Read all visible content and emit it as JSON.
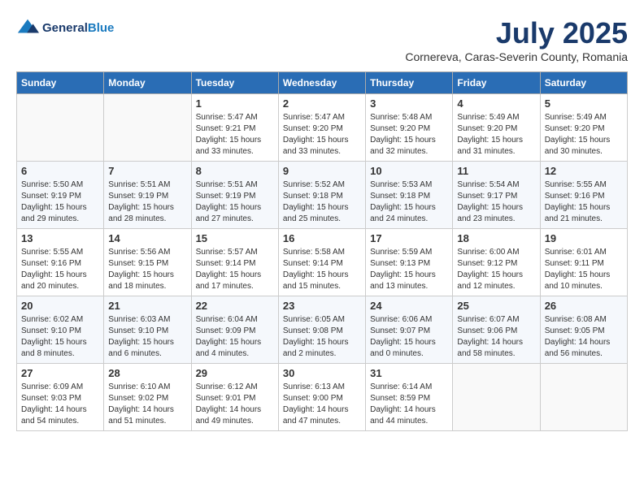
{
  "logo": {
    "general": "General",
    "blue": "Blue"
  },
  "title": "July 2025",
  "subtitle": "Cornereva, Caras-Severin County, Romania",
  "days_header": [
    "Sunday",
    "Monday",
    "Tuesday",
    "Wednesday",
    "Thursday",
    "Friday",
    "Saturday"
  ],
  "weeks": [
    [
      {
        "num": "",
        "detail": ""
      },
      {
        "num": "",
        "detail": ""
      },
      {
        "num": "1",
        "detail": "Sunrise: 5:47 AM\nSunset: 9:21 PM\nDaylight: 15 hours and 33 minutes."
      },
      {
        "num": "2",
        "detail": "Sunrise: 5:47 AM\nSunset: 9:20 PM\nDaylight: 15 hours and 33 minutes."
      },
      {
        "num": "3",
        "detail": "Sunrise: 5:48 AM\nSunset: 9:20 PM\nDaylight: 15 hours and 32 minutes."
      },
      {
        "num": "4",
        "detail": "Sunrise: 5:49 AM\nSunset: 9:20 PM\nDaylight: 15 hours and 31 minutes."
      },
      {
        "num": "5",
        "detail": "Sunrise: 5:49 AM\nSunset: 9:20 PM\nDaylight: 15 hours and 30 minutes."
      }
    ],
    [
      {
        "num": "6",
        "detail": "Sunrise: 5:50 AM\nSunset: 9:19 PM\nDaylight: 15 hours and 29 minutes."
      },
      {
        "num": "7",
        "detail": "Sunrise: 5:51 AM\nSunset: 9:19 PM\nDaylight: 15 hours and 28 minutes."
      },
      {
        "num": "8",
        "detail": "Sunrise: 5:51 AM\nSunset: 9:19 PM\nDaylight: 15 hours and 27 minutes."
      },
      {
        "num": "9",
        "detail": "Sunrise: 5:52 AM\nSunset: 9:18 PM\nDaylight: 15 hours and 25 minutes."
      },
      {
        "num": "10",
        "detail": "Sunrise: 5:53 AM\nSunset: 9:18 PM\nDaylight: 15 hours and 24 minutes."
      },
      {
        "num": "11",
        "detail": "Sunrise: 5:54 AM\nSunset: 9:17 PM\nDaylight: 15 hours and 23 minutes."
      },
      {
        "num": "12",
        "detail": "Sunrise: 5:55 AM\nSunset: 9:16 PM\nDaylight: 15 hours and 21 minutes."
      }
    ],
    [
      {
        "num": "13",
        "detail": "Sunrise: 5:55 AM\nSunset: 9:16 PM\nDaylight: 15 hours and 20 minutes."
      },
      {
        "num": "14",
        "detail": "Sunrise: 5:56 AM\nSunset: 9:15 PM\nDaylight: 15 hours and 18 minutes."
      },
      {
        "num": "15",
        "detail": "Sunrise: 5:57 AM\nSunset: 9:14 PM\nDaylight: 15 hours and 17 minutes."
      },
      {
        "num": "16",
        "detail": "Sunrise: 5:58 AM\nSunset: 9:14 PM\nDaylight: 15 hours and 15 minutes."
      },
      {
        "num": "17",
        "detail": "Sunrise: 5:59 AM\nSunset: 9:13 PM\nDaylight: 15 hours and 13 minutes."
      },
      {
        "num": "18",
        "detail": "Sunrise: 6:00 AM\nSunset: 9:12 PM\nDaylight: 15 hours and 12 minutes."
      },
      {
        "num": "19",
        "detail": "Sunrise: 6:01 AM\nSunset: 9:11 PM\nDaylight: 15 hours and 10 minutes."
      }
    ],
    [
      {
        "num": "20",
        "detail": "Sunrise: 6:02 AM\nSunset: 9:10 PM\nDaylight: 15 hours and 8 minutes."
      },
      {
        "num": "21",
        "detail": "Sunrise: 6:03 AM\nSunset: 9:10 PM\nDaylight: 15 hours and 6 minutes."
      },
      {
        "num": "22",
        "detail": "Sunrise: 6:04 AM\nSunset: 9:09 PM\nDaylight: 15 hours and 4 minutes."
      },
      {
        "num": "23",
        "detail": "Sunrise: 6:05 AM\nSunset: 9:08 PM\nDaylight: 15 hours and 2 minutes."
      },
      {
        "num": "24",
        "detail": "Sunrise: 6:06 AM\nSunset: 9:07 PM\nDaylight: 15 hours and 0 minutes."
      },
      {
        "num": "25",
        "detail": "Sunrise: 6:07 AM\nSunset: 9:06 PM\nDaylight: 14 hours and 58 minutes."
      },
      {
        "num": "26",
        "detail": "Sunrise: 6:08 AM\nSunset: 9:05 PM\nDaylight: 14 hours and 56 minutes."
      }
    ],
    [
      {
        "num": "27",
        "detail": "Sunrise: 6:09 AM\nSunset: 9:03 PM\nDaylight: 14 hours and 54 minutes."
      },
      {
        "num": "28",
        "detail": "Sunrise: 6:10 AM\nSunset: 9:02 PM\nDaylight: 14 hours and 51 minutes."
      },
      {
        "num": "29",
        "detail": "Sunrise: 6:12 AM\nSunset: 9:01 PM\nDaylight: 14 hours and 49 minutes."
      },
      {
        "num": "30",
        "detail": "Sunrise: 6:13 AM\nSunset: 9:00 PM\nDaylight: 14 hours and 47 minutes."
      },
      {
        "num": "31",
        "detail": "Sunrise: 6:14 AM\nSunset: 8:59 PM\nDaylight: 14 hours and 44 minutes."
      },
      {
        "num": "",
        "detail": ""
      },
      {
        "num": "",
        "detail": ""
      }
    ]
  ]
}
